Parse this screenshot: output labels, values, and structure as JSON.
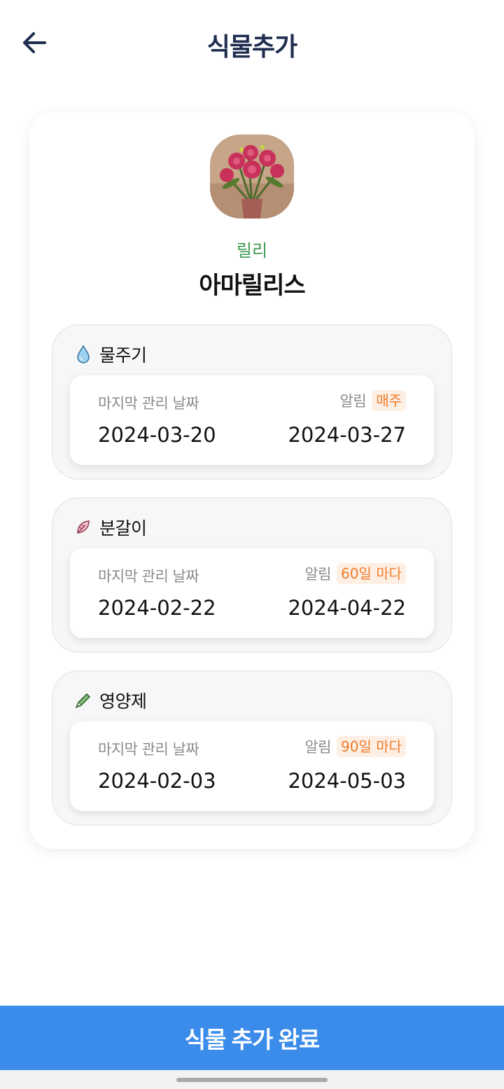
{
  "header": {
    "title": "식물추가"
  },
  "plant": {
    "nickname": "릴리",
    "name": "아마릴리스"
  },
  "care_items": [
    {
      "icon": "water-drop-icon",
      "label": "물주기",
      "last_label": "마지막 관리 날짜",
      "last_date": "2024-03-20",
      "alarm_label": "알림",
      "alarm_cycle": "매주",
      "next_date": "2024-03-27"
    },
    {
      "icon": "repot-leaf-icon",
      "label": "분갈이",
      "last_label": "마지막 관리 날짜",
      "last_date": "2024-02-22",
      "alarm_label": "알림",
      "alarm_cycle": "60일 마다",
      "next_date": "2024-04-22"
    },
    {
      "icon": "nutrient-ampoule-icon",
      "label": "영양제",
      "last_label": "마지막 관리 날짜",
      "last_date": "2024-02-03",
      "alarm_label": "알림",
      "alarm_cycle": "90일 마다",
      "next_date": "2024-05-03"
    }
  ],
  "footer": {
    "submit_label": "식물 추가 완료"
  },
  "colors": {
    "title": "#1f2d4f",
    "nickname": "#3e9a54",
    "accent_orange": "#f07c2c",
    "button_blue": "#3b8cea"
  }
}
